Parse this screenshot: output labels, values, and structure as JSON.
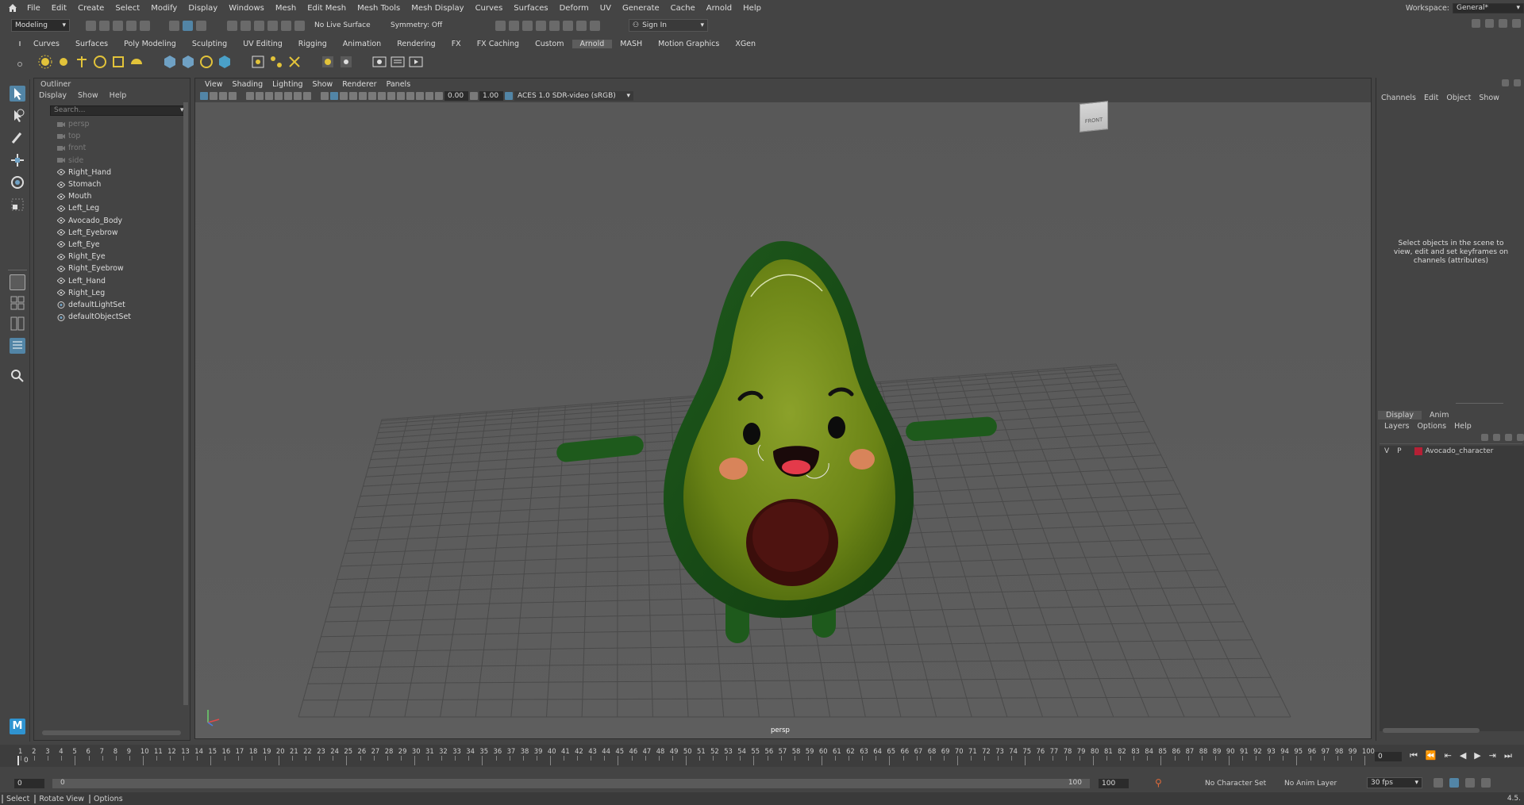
{
  "menubar": {
    "items": [
      "File",
      "Edit",
      "Create",
      "Select",
      "Modify",
      "Display",
      "Windows",
      "Mesh",
      "Edit Mesh",
      "Mesh Tools",
      "Mesh Display",
      "Curves",
      "Surfaces",
      "Deform",
      "UV",
      "Generate",
      "Cache",
      "Arnold",
      "Help"
    ],
    "workspace_label": "Workspace:",
    "workspace_value": "General*"
  },
  "statusline": {
    "mode": "Modeling",
    "live_surface": "No Live Surface",
    "symmetry": "Symmetry: Off",
    "sign_in": "Sign In"
  },
  "shelf": {
    "tabs": [
      "Curves",
      "Surfaces",
      "Poly Modeling",
      "Sculpting",
      "UV Editing",
      "Rigging",
      "Animation",
      "Rendering",
      "FX",
      "FX Caching",
      "Custom",
      "Arnold",
      "MASH",
      "Motion Graphics",
      "XGen"
    ],
    "active_tab": "Arnold"
  },
  "outliner": {
    "title": "Outliner",
    "menu": [
      "Display",
      "Show",
      "Help"
    ],
    "search_placeholder": "Search...",
    "items": [
      {
        "name": "persp",
        "kind": "camera",
        "dim": true
      },
      {
        "name": "top",
        "kind": "camera",
        "dim": true
      },
      {
        "name": "front",
        "kind": "camera",
        "dim": true
      },
      {
        "name": "side",
        "kind": "camera",
        "dim": true
      },
      {
        "name": "Right_Hand",
        "kind": "mesh",
        "dim": false
      },
      {
        "name": "Stomach",
        "kind": "mesh",
        "dim": false
      },
      {
        "name": "Mouth",
        "kind": "mesh",
        "dim": false
      },
      {
        "name": "Left_Leg",
        "kind": "mesh",
        "dim": false
      },
      {
        "name": "Avocado_Body",
        "kind": "mesh",
        "dim": false
      },
      {
        "name": "Left_Eyebrow",
        "kind": "mesh",
        "dim": false
      },
      {
        "name": "Left_Eye",
        "kind": "mesh",
        "dim": false
      },
      {
        "name": "Right_Eye",
        "kind": "mesh",
        "dim": false
      },
      {
        "name": "Right_Eyebrow",
        "kind": "mesh",
        "dim": false
      },
      {
        "name": "Left_Hand",
        "kind": "mesh",
        "dim": false
      },
      {
        "name": "Right_Leg",
        "kind": "mesh",
        "dim": false
      },
      {
        "name": "defaultLightSet",
        "kind": "set",
        "dim": false
      },
      {
        "name": "defaultObjectSet",
        "kind": "set",
        "dim": false
      }
    ]
  },
  "viewport": {
    "menu": [
      "View",
      "Shading",
      "Lighting",
      "Show",
      "Renderer",
      "Panels"
    ],
    "exposure": "0.00",
    "gamma": "1.00",
    "color_space": "ACES 1.0 SDR-video (sRGB)",
    "camera_label": "persp",
    "viewcube_label": "FRONT"
  },
  "channel_box": {
    "menu": [
      "Channels",
      "Edit",
      "Object",
      "Show"
    ],
    "empty_message": "Select objects in the scene to view, edit and set keyframes on channels (attributes)"
  },
  "layer_editor": {
    "tabs": [
      "Display",
      "Anim"
    ],
    "menu": [
      "Layers",
      "Options",
      "Help"
    ],
    "layers": [
      {
        "v": "V",
        "p": "P",
        "name": "Avocado_character",
        "color": "#b52035"
      }
    ]
  },
  "timeline": {
    "start": 1,
    "end": 100,
    "current_frame": "0",
    "current_frame_left": "0"
  },
  "range": {
    "start": "0",
    "inner_start": "0",
    "inner_end": "100",
    "end": "100",
    "character_set": "No Character Set",
    "anim_layer": "No Anim Layer",
    "fps": "30 fps"
  },
  "helpline": {
    "select": "Select",
    "rotate": "Rotate View",
    "options": "Options",
    "version": "4.5."
  },
  "colors": {
    "accent": "#5285a6",
    "bg": "#444444",
    "viewport": "#5b5b5b"
  }
}
